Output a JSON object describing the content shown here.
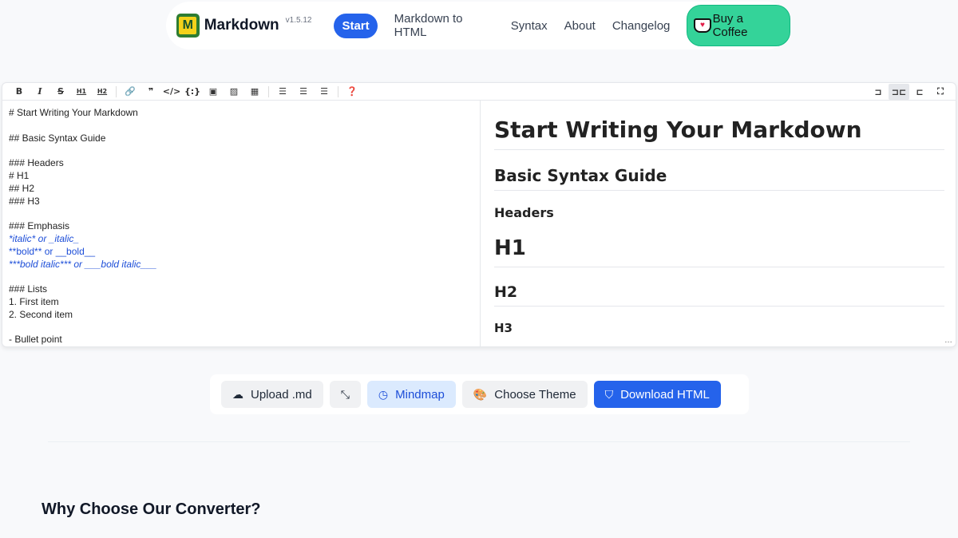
{
  "nav": {
    "brand": "Markdown",
    "version": "v1.5.12",
    "start": "Start",
    "links": [
      "Markdown to HTML",
      "Syntax",
      "About",
      "Changelog"
    ],
    "coffee": "Buy a Coffee"
  },
  "toolbar": {
    "left": [
      "B",
      "I",
      "S",
      "H",
      "H",
      "link",
      "quote",
      "code",
      "code-block",
      "comment",
      "image",
      "table",
      "ul",
      "ol",
      "task",
      "help"
    ],
    "right": [
      "split-left",
      "split-both",
      "split-right",
      "fullscreen"
    ]
  },
  "editor": {
    "lines": [
      "# Start Writing Your Markdown",
      "",
      "## Basic Syntax Guide",
      "",
      "### Headers",
      "# H1",
      "## H2",
      "### H3",
      "",
      "### Emphasis",
      "*italic* or _italic_",
      "**bold** or __bold__",
      "***bold italic*** or ___bold italic___",
      "",
      "### Lists",
      "1. First item",
      "2. Second item",
      "",
      "- Bullet point"
    ]
  },
  "preview": {
    "h1": "Start Writing Your Markdown",
    "h2": "Basic Syntax Guide",
    "h3": "Headers",
    "h1b": "H1",
    "h2b": "H2",
    "h3b": "H3"
  },
  "actions": {
    "upload": "Upload .md",
    "mindmap": "Mindmap",
    "theme": "Choose Theme",
    "download": "Download HTML"
  },
  "section": {
    "title": "Why Choose Our Converter?"
  }
}
